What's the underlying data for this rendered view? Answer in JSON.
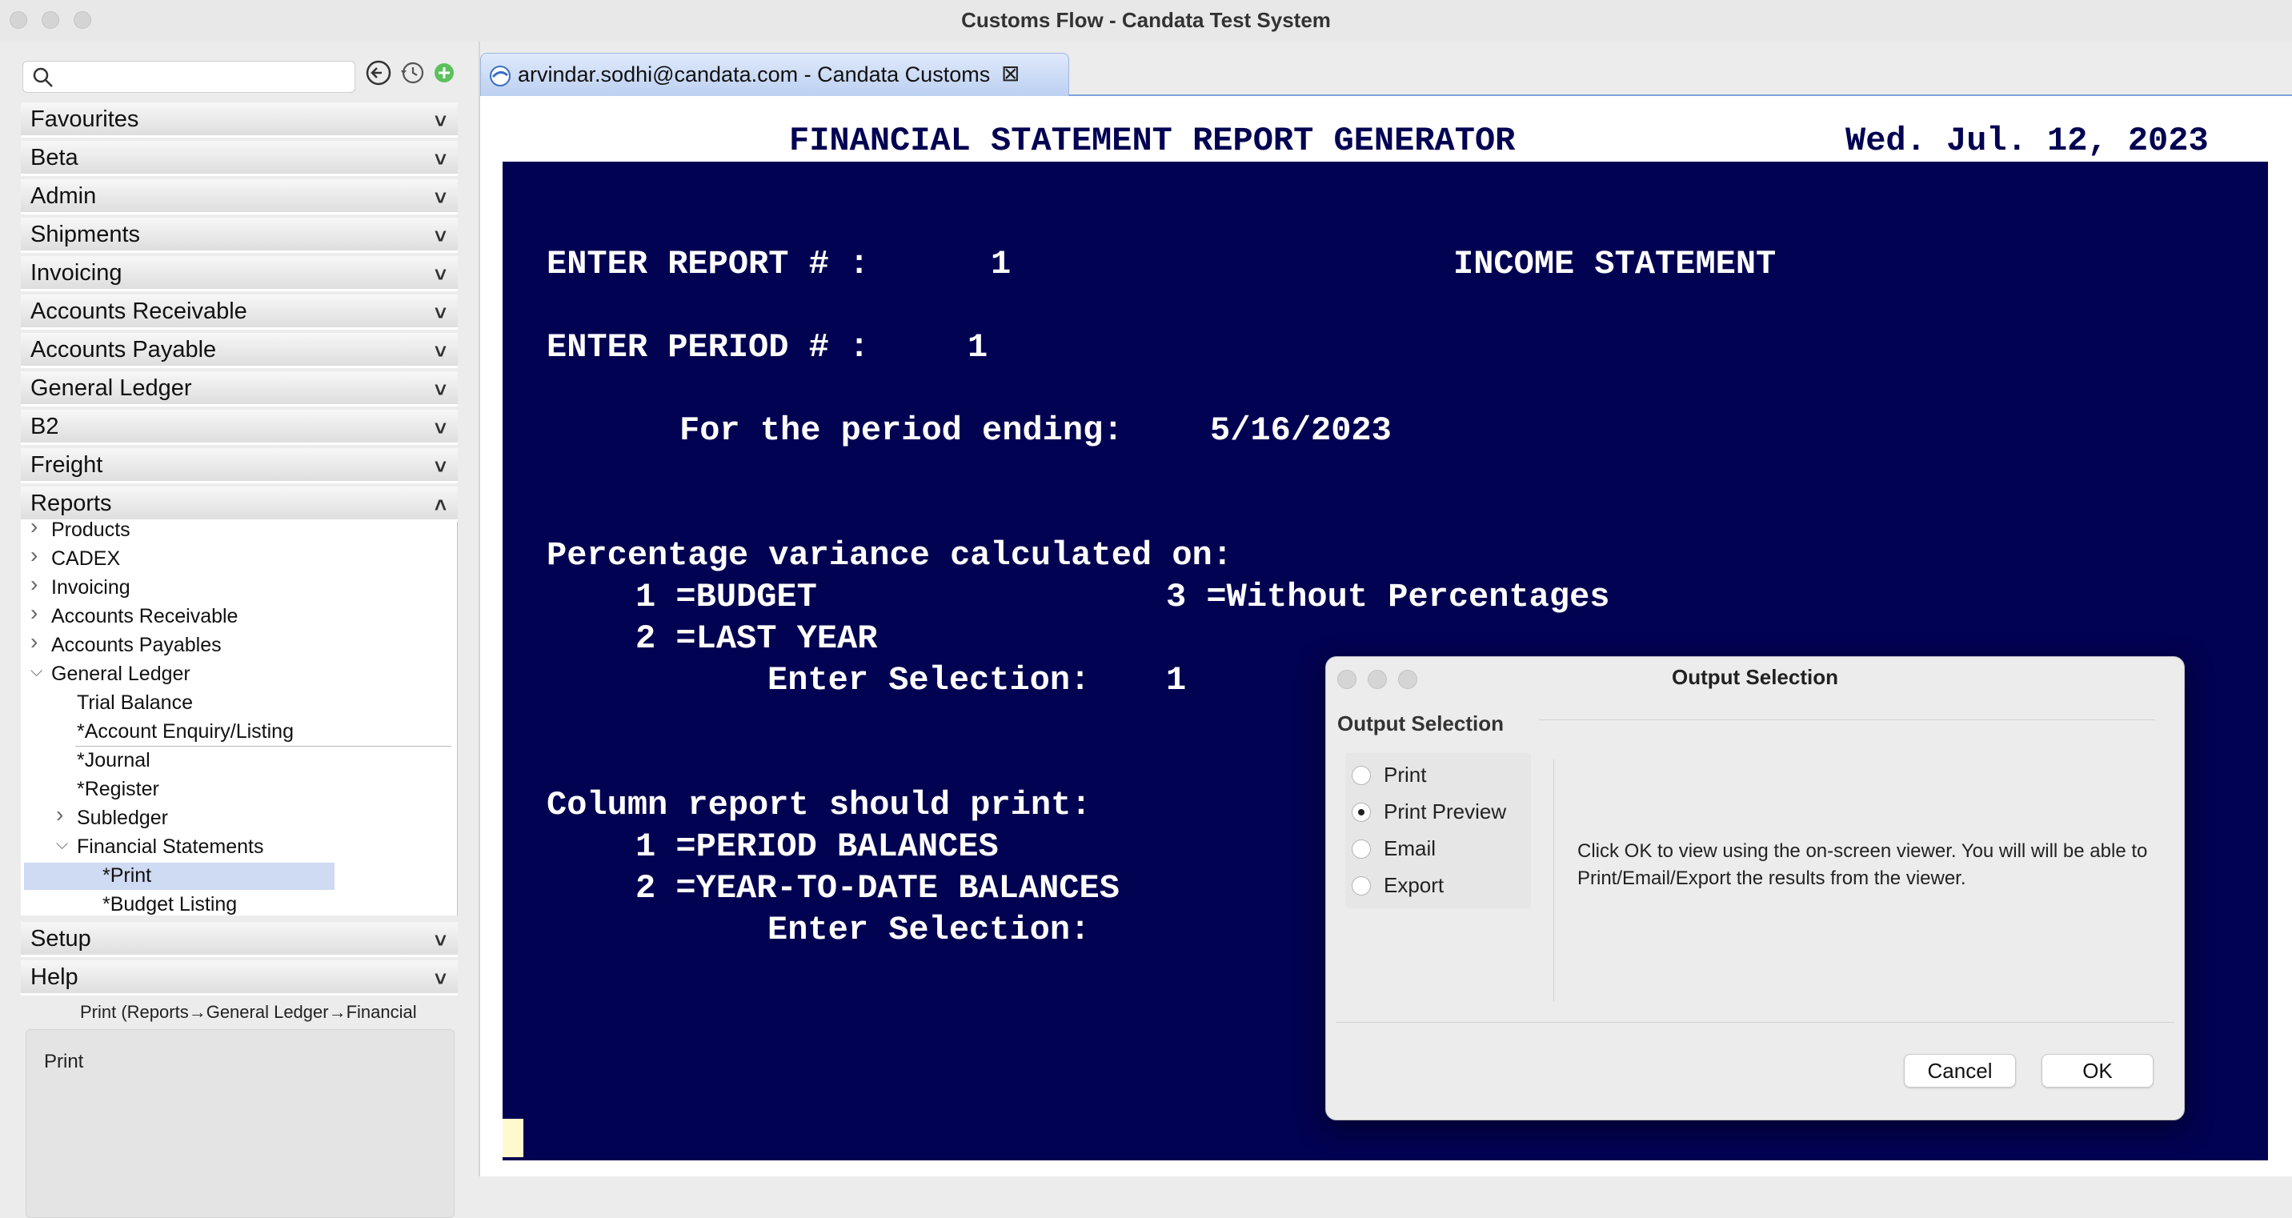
{
  "window": {
    "title": "Customs Flow - Candata Test System"
  },
  "sidebar": {
    "search_placeholder": "",
    "accordion_top": [
      {
        "label": "Favourites"
      },
      {
        "label": "Beta"
      },
      {
        "label": "Admin"
      },
      {
        "label": "Shipments"
      },
      {
        "label": "Invoicing"
      },
      {
        "label": "Accounts Receivable"
      },
      {
        "label": "Accounts Payable"
      },
      {
        "label": "General Ledger"
      },
      {
        "label": "B2"
      },
      {
        "label": "Freight"
      },
      {
        "label": "Reports"
      }
    ],
    "tree": [
      {
        "label": "Products",
        "expanded": false
      },
      {
        "label": "CADEX",
        "expanded": false
      },
      {
        "label": "Invoicing",
        "expanded": false
      },
      {
        "label": "Accounts Receivable",
        "expanded": false
      },
      {
        "label": "Accounts Payables",
        "expanded": false
      },
      {
        "label": "General Ledger",
        "expanded": true
      },
      {
        "label": "Trial Balance"
      },
      {
        "label": "*Account Enquiry/Listing"
      },
      {
        "label": "*Journal"
      },
      {
        "label": "*Register"
      },
      {
        "label": "Subledger",
        "expanded": false
      },
      {
        "label": "Financial Statements",
        "expanded": true
      },
      {
        "label": "*Print",
        "selected": true
      },
      {
        "label": "*Budget Listing"
      }
    ],
    "accordion_bottom": [
      {
        "label": "Setup"
      },
      {
        "label": "Help"
      }
    ],
    "breadcrumb": "Print (Reports→General Ledger→Financial",
    "description": "Print"
  },
  "tab": {
    "label": "arvindar.sodhi@candata.com - Candata Customs"
  },
  "terminal": {
    "header_title": "FINANCIAL STATEMENT REPORT GENERATOR",
    "header_date": "Wed. Jul. 12, 2023",
    "report_prompt": "ENTER REPORT # :",
    "report_value": "1",
    "report_name": "INCOME STATEMENT",
    "period_prompt": "ENTER PERIOD # :",
    "period_value": "1",
    "period_ending_label": "For the period ending:",
    "period_ending_value": "5/16/2023",
    "variance_title": "Percentage variance calculated on:",
    "variance_opt1": "1 =BUDGET",
    "variance_opt3": "3 =Without Percentages",
    "variance_opt2": "2 =LAST YEAR",
    "selection_label": "Enter Selection:",
    "variance_selection": "1",
    "column_title": "Column report should print:",
    "column_opt1": "1 =PERIOD BALANCES",
    "column_opt2": "2 =YEAR-TO-DATE BALANCES",
    "column_selection_label": "Enter Selection:"
  },
  "dialog": {
    "title": "Output Selection",
    "group_label": "Output Selection",
    "options": [
      {
        "label": "Print",
        "selected": false
      },
      {
        "label": "Print Preview",
        "selected": true
      },
      {
        "label": "Email",
        "selected": false
      },
      {
        "label": "Export",
        "selected": false
      }
    ],
    "message": "Click OK to view using the on-screen viewer.  You will will be able to Print/Email/Export the results from the viewer.",
    "cancel_label": "Cancel",
    "ok_label": "OK"
  },
  "colors": {
    "terminal_bg": "#020252",
    "selection": "#cfdaf3",
    "tab_accent": "#7ea3df"
  }
}
